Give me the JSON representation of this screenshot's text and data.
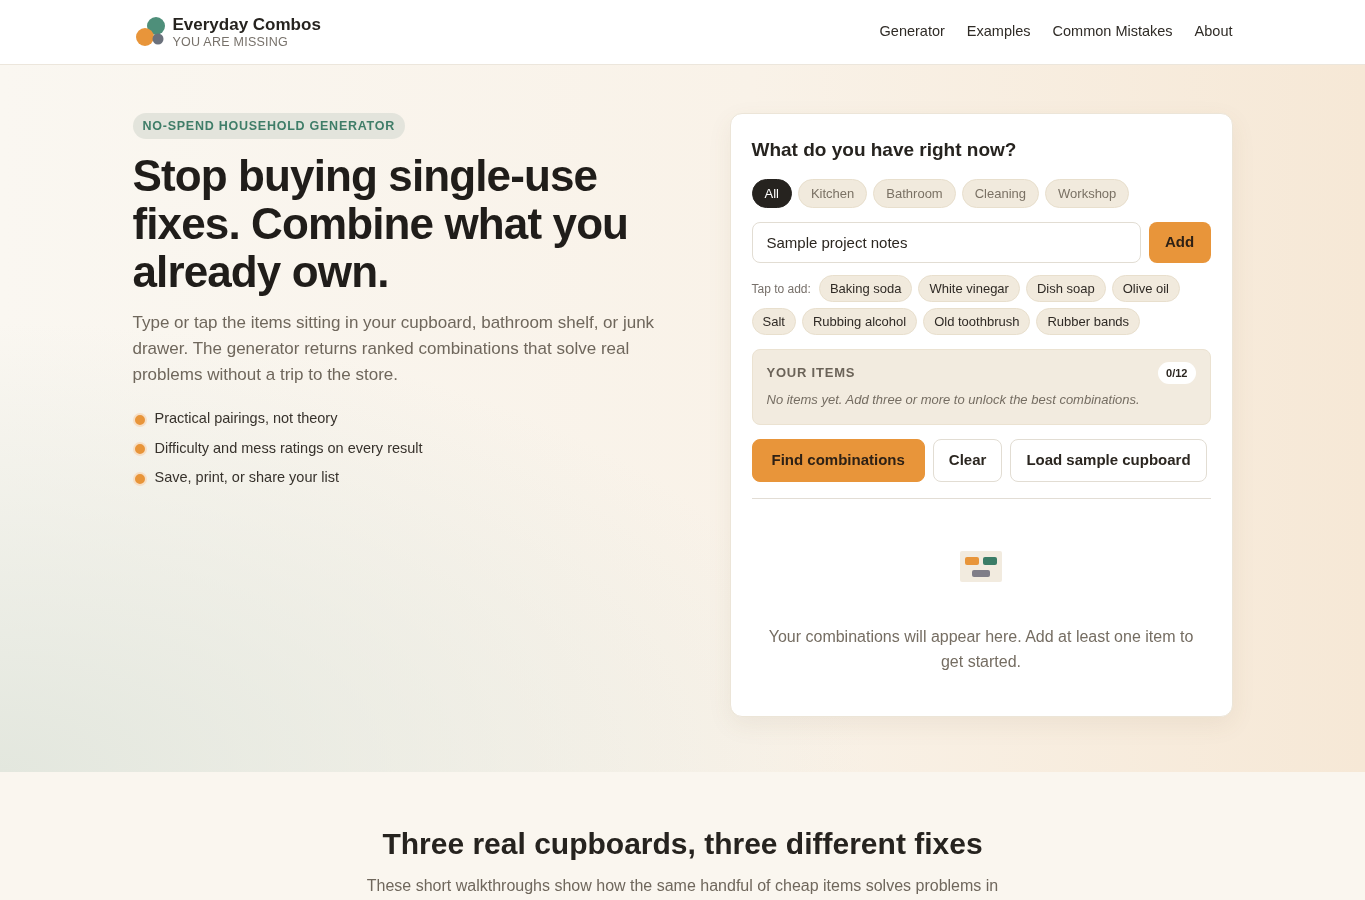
{
  "header": {
    "logo": {
      "title": "Everyday Combos",
      "subtitle": "YOU ARE MISSING"
    },
    "nav": [
      "Generator",
      "Examples",
      "Common Mistakes",
      "About"
    ]
  },
  "hero": {
    "badge": "NO-SPEND HOUSEHOLD GENERATOR",
    "heading": "Stop buying single-use fixes. Combine what you already own.",
    "intro": "Type or tap the items sitting in your cupboard, bathroom shelf, or junk drawer. The generator returns ranked combinations that solve real problems without a trip to the store.",
    "bullets": [
      "Practical pairings, not theory",
      "Difficulty and mess ratings on every result",
      "Save, print, or share your list"
    ]
  },
  "generator": {
    "title": "What do you have right now?",
    "filters": [
      {
        "label": "All",
        "selected": true
      },
      {
        "label": "Kitchen",
        "selected": false
      },
      {
        "label": "Bathroom",
        "selected": false
      },
      {
        "label": "Cleaning",
        "selected": false
      },
      {
        "label": "Workshop",
        "selected": false
      }
    ],
    "input": {
      "value": "Sample project notes"
    },
    "add_button": "Add",
    "suggestions": {
      "label": "Tap to add:",
      "items": [
        "Baking soda",
        "White vinegar",
        "Dish soap",
        "Olive oil",
        "Salt",
        "Rubbing alcohol",
        "Old toothbrush",
        "Rubber bands"
      ]
    },
    "your_items": {
      "title": "YOUR ITEMS",
      "count": "0/12",
      "empty_text": "No items yet. Add three or more to unlock the best combinations."
    },
    "actions": [
      {
        "label": "Find combinations",
        "kind": "primary"
      },
      {
        "label": "Clear",
        "kind": "secondary"
      },
      {
        "label": "Load sample cupboard",
        "kind": "secondary"
      }
    ],
    "empty_state": {
      "text": "Your combinations will appear here. Add at least one item to get started."
    }
  },
  "examples_section": {
    "title": "Three real cupboards, three different fixes",
    "intro": "These short walkthroughs show how the same handful of cheap items solves problems in"
  }
}
